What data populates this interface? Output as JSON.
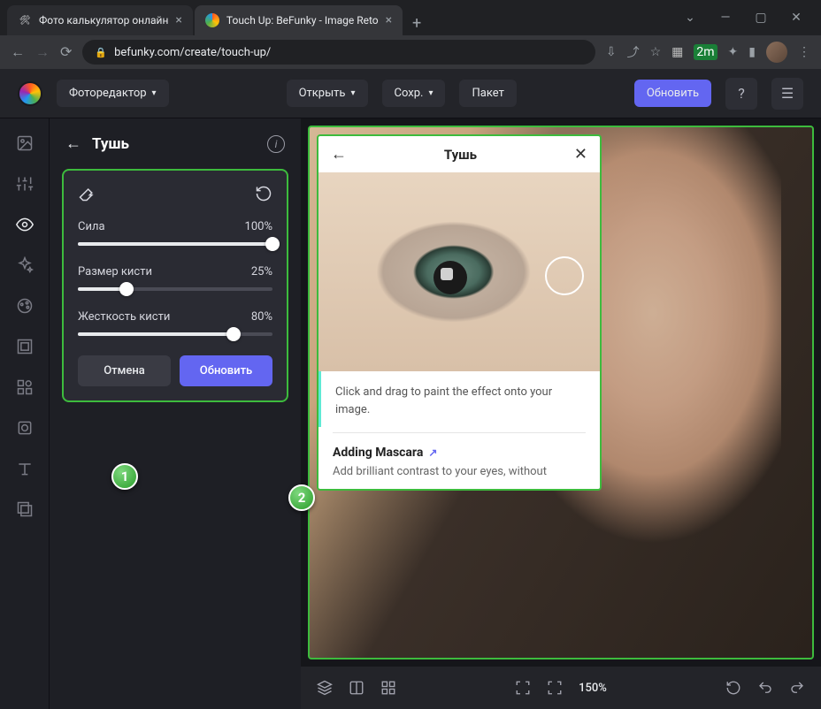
{
  "browser": {
    "tabs": [
      {
        "title": "Фото калькулятор онлайн",
        "active": false
      },
      {
        "title": "Touch Up: BeFunky - Image Reto",
        "active": true
      }
    ],
    "url": "befunky.com/create/touch-up/"
  },
  "header": {
    "editor_label": "Фоторедактор",
    "open": "Открыть",
    "save": "Сохр.",
    "batch": "Пакет",
    "upgrade": "Обновить"
  },
  "panel": {
    "title": "Тушь",
    "sliders": {
      "strength": {
        "label": "Сила",
        "value": "100%",
        "pct": 100
      },
      "brush_size": {
        "label": "Размер кисти",
        "value": "25%",
        "pct": 25
      },
      "hardness": {
        "label": "Жесткость кисти",
        "value": "80%",
        "pct": 80
      }
    },
    "cancel": "Отмена",
    "apply": "Обновить"
  },
  "tip": {
    "title": "Тушь",
    "body": "Click and drag to paint the effect onto your image.",
    "article_title": "Adding Mascara",
    "article_text": "Add brilliant contrast to your eyes, without"
  },
  "zoom": "150%",
  "annotations": {
    "a1": "1",
    "a2": "2"
  }
}
